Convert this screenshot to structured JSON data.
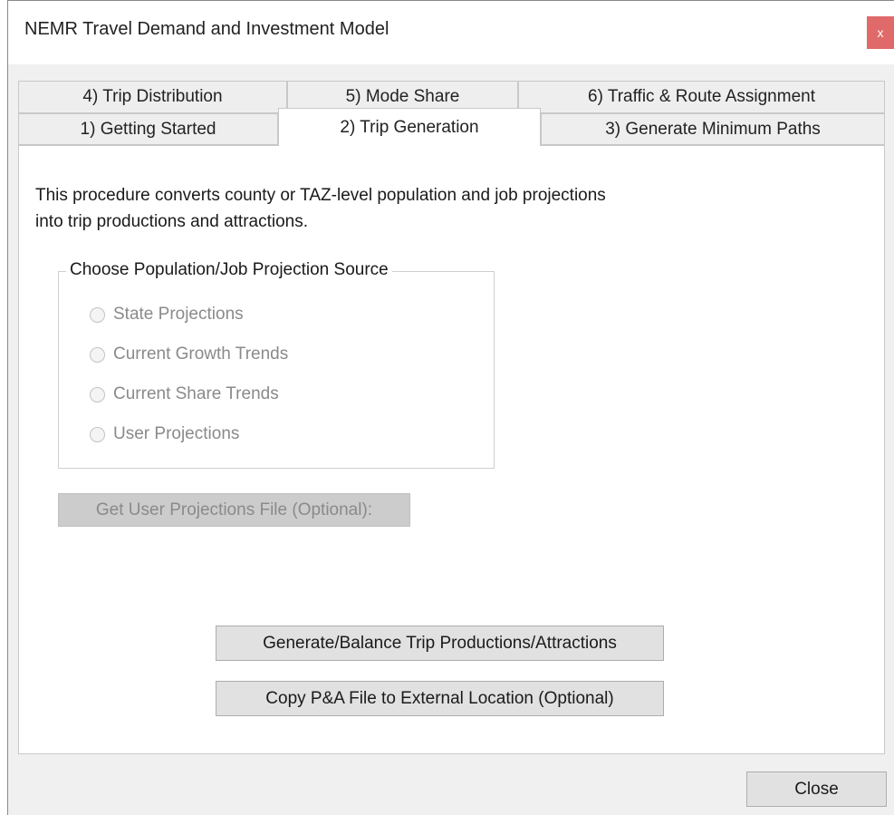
{
  "window": {
    "title": "NEMR Travel Demand and Investment Model",
    "close_glyph": "x"
  },
  "tabs": {
    "row_back": [
      {
        "label": "4) Trip Distribution"
      },
      {
        "label": "5) Mode Share"
      },
      {
        "label": "6) Traffic & Route Assignment"
      }
    ],
    "row_front": [
      {
        "label": "1) Getting Started"
      },
      {
        "label": "2) Trip Generation",
        "active": true
      },
      {
        "label": "3) Generate Minimum Paths"
      }
    ]
  },
  "panel": {
    "description_line1": "This procedure converts county or TAZ-level population and job projections",
    "description_line2": "into trip productions and attractions.",
    "group": {
      "legend": "Choose Population/Job Projection Source",
      "options": [
        {
          "label": "State Projections",
          "selected": false,
          "enabled": false
        },
        {
          "label": "Current Growth Trends",
          "selected": false,
          "enabled": false
        },
        {
          "label": "Current Share Trends",
          "selected": false,
          "enabled": false
        },
        {
          "label": "User Projections",
          "selected": false,
          "enabled": false
        }
      ]
    },
    "get_file_button": "Get User Projections File (Optional):",
    "generate_button": "Generate/Balance Trip Productions/Attractions",
    "copy_button": "Copy P&A File to External Location (Optional)"
  },
  "footer": {
    "close_button": "Close"
  },
  "colors": {
    "window_bg": "#f0f0f0",
    "panel_bg": "#ffffff",
    "close_red": "#e06a6a",
    "disabled_text": "#8a8a8a"
  }
}
